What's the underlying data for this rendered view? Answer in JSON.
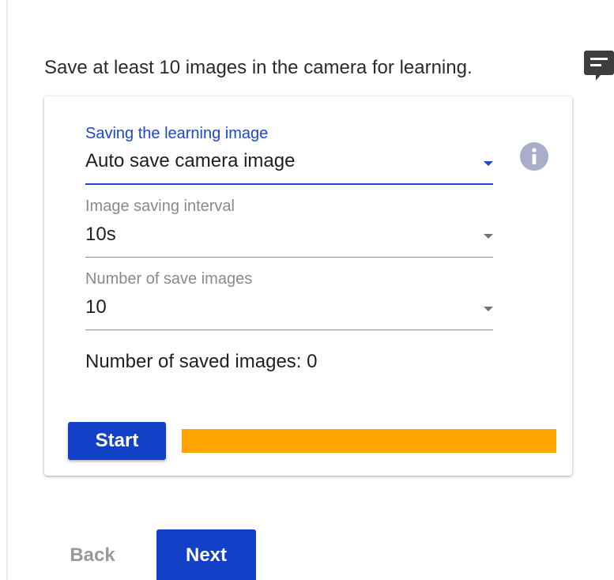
{
  "instruction": "Save at least 10 images in the camera for learning.",
  "icons": {
    "feedback": "comment-icon",
    "info": "info-icon",
    "dropdown": "caret-down-icon"
  },
  "colors": {
    "accent": "#1241c8",
    "progress": "#ffa500",
    "label_active": "#1c46d0"
  },
  "form": {
    "saving_mode": {
      "label": "Saving the learning image",
      "value": "Auto save camera image"
    },
    "interval": {
      "label": "Image saving interval",
      "value": "10s"
    },
    "save_count": {
      "label": "Number of save images",
      "value": "10"
    },
    "saved_images_text": "Number of saved images: 0"
  },
  "actions": {
    "start_label": "Start",
    "progress_fraction": 1.0
  },
  "nav": {
    "back_label": "Back",
    "next_label": "Next"
  }
}
